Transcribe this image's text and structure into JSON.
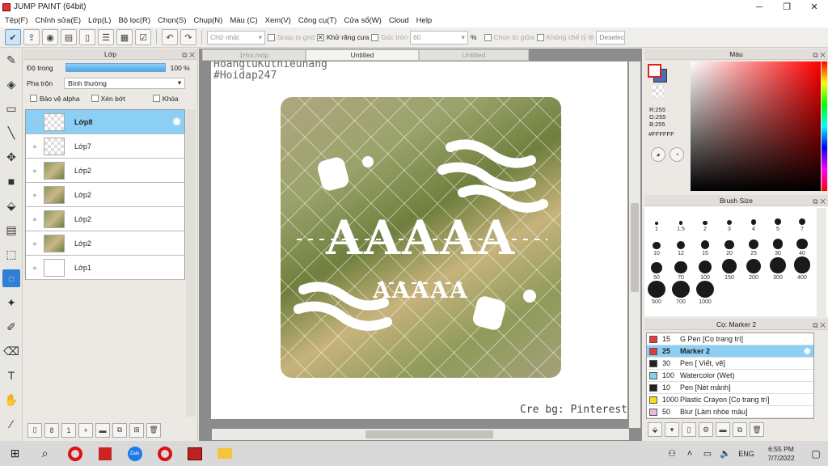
{
  "window": {
    "title": "JUMP PAINT (64bit)",
    "minimize": "─",
    "restore": "❐",
    "close": "✕"
  },
  "menu": [
    "Tệp(F)",
    "Chỉnh sửa(E)",
    "Lớp(L)",
    "Bộ lọc(R)",
    "Chọn(S)",
    "Chụp(N)",
    "Màu (C)",
    "Xem(V)",
    "Công cụ(T)",
    "Cửa sổ(W)",
    "Cloud",
    "Help"
  ],
  "toolbar": {
    "shape_select": "Chữ nhật",
    "snap_grid": "Snap to grid",
    "antialias": "Khử răng cưa",
    "corner": "Góc tròn",
    "corner_value": "60",
    "percent": "%",
    "select_center": "Chọn từ giữa",
    "no_ratio": "Không chế tỷ lệ",
    "deselect": "Deselec"
  },
  "layers_panel": {
    "title": "Lớp",
    "opacity_label": "Độ trong",
    "opacity_value": "100 %",
    "opacity_fraction": 1.0,
    "blend_label": "Pha trộn",
    "blend_value": "Bình thường",
    "protect_alpha": "Bảo vệ alpha",
    "clip": "Xén bớt",
    "lock": "Khóa",
    "layers": [
      {
        "name": "Lớp8",
        "selected": true,
        "thumb": "checker"
      },
      {
        "name": "Lớp7",
        "selected": false,
        "thumb": "checker"
      },
      {
        "name": "Lớp2",
        "selected": false,
        "thumb": "img"
      },
      {
        "name": "Lớp2",
        "selected": false,
        "thumb": "img"
      },
      {
        "name": "Lớp2",
        "selected": false,
        "thumb": "img"
      },
      {
        "name": "Lớp2",
        "selected": false,
        "thumb": "img"
      },
      {
        "name": "Lớp1",
        "selected": false,
        "thumb": "blank"
      }
    ]
  },
  "canvas": {
    "tabs": [
      "1Hoi.mdp",
      "Untitled",
      "Untitled"
    ],
    "header_line1": "HoangtuKuthieunang",
    "header_line2": "#Hoidap247",
    "overlay_text_big": "AAAAA",
    "overlay_text_small": "AAAAA",
    "credit": "Cre bg: Pinterest"
  },
  "color_panel": {
    "title": "Màu",
    "r": "R:255",
    "g": "G:255",
    "b": "B:255",
    "hex": "#FFFFFF",
    "fg": "#ffffff",
    "bg": "#4a6fb5"
  },
  "brush_panel": {
    "title": "Brush Size",
    "sizes": [
      "1",
      "1.5",
      "2",
      "3",
      "4",
      "5",
      "7",
      "10",
      "12",
      "15",
      "20",
      "25",
      "30",
      "40",
      "50",
      "70",
      "100",
      "150",
      "200",
      "300",
      "400",
      "500",
      "700",
      "1000"
    ]
  },
  "subtool_panel": {
    "title": "Cọ: Marker 2",
    "items": [
      {
        "size": "15",
        "name": "G Pen [Cọ trang trí]",
        "color": "#e33b3b",
        "selected": false
      },
      {
        "size": "25",
        "name": "Marker 2",
        "color": "#e33b3b",
        "selected": true
      },
      {
        "size": "30",
        "name": "Pen [ Viết, vẽ]",
        "color": "#222222",
        "selected": false
      },
      {
        "size": "100",
        "name": "Watercolor (Wet)",
        "color": "#7fd3f0",
        "selected": false
      },
      {
        "size": "10",
        "name": "Pen [Nét mảnh]",
        "color": "#222222",
        "selected": false
      },
      {
        "size": "1000",
        "name": "Plastic Crayon [Cọ trang trí]",
        "color": "#f2e017",
        "selected": false
      },
      {
        "size": "50",
        "name": "Blur [Làm nhòe màu]",
        "color": "#f0b8e0",
        "selected": false
      }
    ]
  },
  "taskbar": {
    "lang": "ENG",
    "time": "6:55 PM",
    "date": "7/7/2022",
    "zalo": "Zalo"
  }
}
